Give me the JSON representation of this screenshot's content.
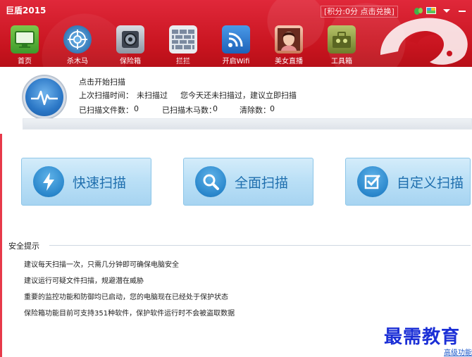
{
  "app": {
    "title": "巨盾2015"
  },
  "header": {
    "points_text": "[积分:0分 点击兑换]",
    "colors": {
      "bar": "#c8141f",
      "button_blue": "#1f6fae"
    }
  },
  "nav": [
    {
      "label": "首页",
      "icon": "monitor-icon"
    },
    {
      "label": "杀木马",
      "icon": "crosshair-icon"
    },
    {
      "label": "保险箱",
      "icon": "safe-icon"
    },
    {
      "label": "拦拦",
      "icon": "firewall-icon"
    },
    {
      "label": "开启Wifi",
      "icon": "wifi-icon"
    },
    {
      "label": "美女直播",
      "icon": "live-icon"
    },
    {
      "label": "工具箱",
      "icon": "toolbox-icon"
    }
  ],
  "status": {
    "prompt": "点击开始扫描",
    "last_scan_label": "上次扫描时间：",
    "last_scan_value": "未扫描过",
    "advice": "您今天还未扫描过，建议立即扫描",
    "files_label": "已扫描文件数：",
    "files_value": "0",
    "trojans_label": "已扫描木马数：",
    "trojans_value": "0",
    "cleared_label": "清除数：",
    "cleared_value": "0"
  },
  "buttons": {
    "quick": "快速扫描",
    "full": "全面扫描",
    "custom": "自定义扫描"
  },
  "tips": {
    "title": "安全提示",
    "items": [
      "建议每天扫描一次，只需几分钟即可确保电脑安全",
      "建议运行可疑文件扫描，规避潜在威胁",
      "重要的监控功能和防御均已启动，您的电脑现在已经处于保护状态",
      "保险箱功能目前可支持351种软件，保护软件运行时不会被盗取数据"
    ]
  },
  "watermark": "最需教育",
  "footer": {
    "advanced": "高级功能"
  }
}
